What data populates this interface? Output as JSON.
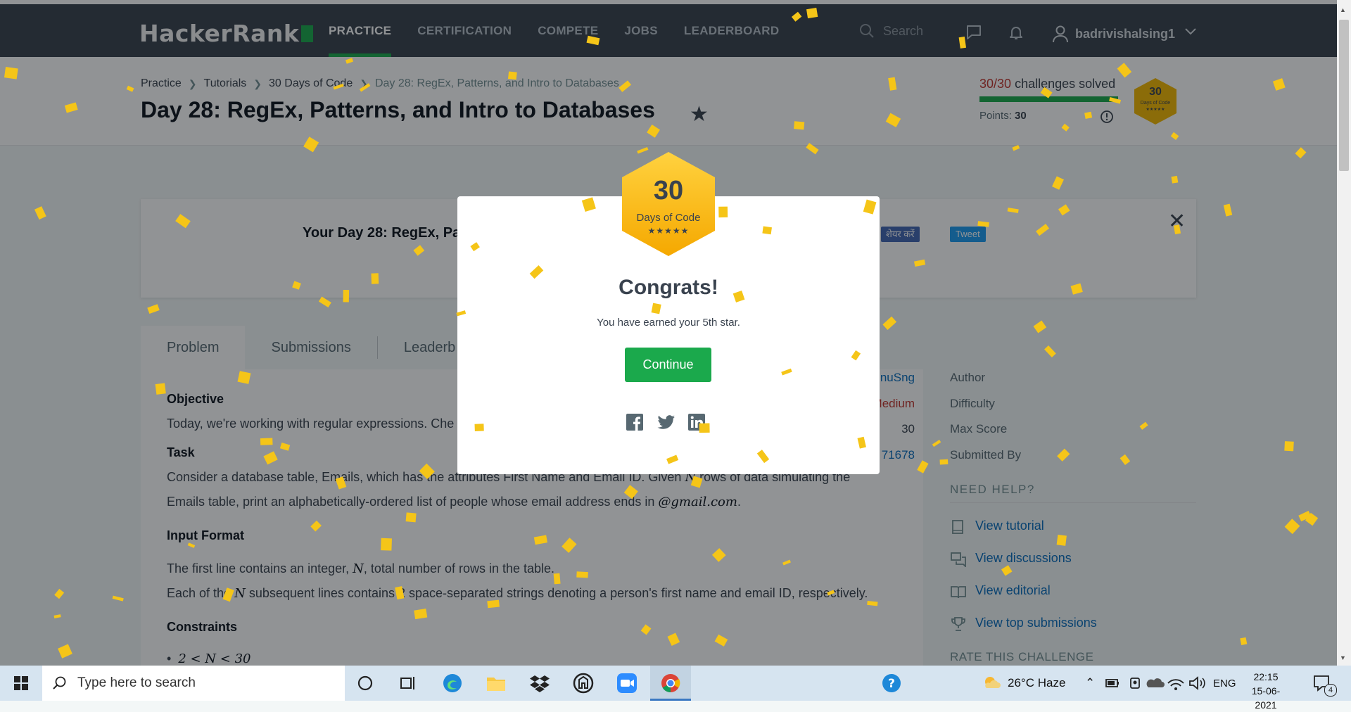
{
  "nav": {
    "logo": "HackerRank",
    "links": [
      "PRACTICE",
      "CERTIFICATION",
      "COMPETE",
      "JOBS",
      "LEADERBOARD"
    ],
    "search_placeholder": "Search",
    "username": "badrivishalsing1",
    "icons": [
      "messages-icon",
      "notifications-icon",
      "user-icon",
      "chevron-down-icon"
    ]
  },
  "breadcrumbs": [
    "Practice",
    "Tutorials",
    "30 Days of Code",
    "Day 28: RegEx, Patterns, and Intro to Databases"
  ],
  "title": "Day 28: RegEx, Patterns, and Intro to Databases",
  "progress": {
    "solved_num": "30/30",
    "solved_text": "challenges solved",
    "points_label": "Points:",
    "points_value": "30",
    "fraction": 1.0,
    "badge_num": "30",
    "badge_text": "Days of Code",
    "badge_stars": "★★★★★"
  },
  "banner": {
    "text": "Your Day 28: RegEx, Pa",
    "share_fb": "शेयर करें",
    "share_tw": "Tweet"
  },
  "tabs": [
    "Problem",
    "Submissions",
    "Leaderb"
  ],
  "problem": {
    "objective_heading": "Objective",
    "objective_text": "Today, we're working with regular expressions. Che",
    "task_heading": "Task",
    "task_line1_a": "Consider a database table, Emails, which has the attributes First Name and Email ID. Given ",
    "task_line1_math": "N",
    "task_line1_b": " rows of data simulating the",
    "task_line2_a": "Emails table, print an alphabetically-ordered list of people whose email address ends in ",
    "task_line2_math": "@gmail.com",
    "task_line2_b": ".",
    "input_heading": "Input Format",
    "input_line1_a": "The first line contains an integer, ",
    "input_line1_math": "N",
    "input_line1_b": ", total number of rows in the table.",
    "input_line2_a": "Each of the ",
    "input_line2_math": "N",
    "input_line2_b": " subsequent lines contains 2 space-separated strings denoting a person's first name and email ID, respectively.",
    "constraints_heading": "Constraints",
    "constraint_1": "2 < N < 30"
  },
  "sidebar": {
    "author_label": "Author",
    "author_value": "AvmnuSng",
    "difficulty_label": "Difficulty",
    "difficulty_value": "Medium",
    "max_score_label": "Max Score",
    "max_score_value": "30",
    "submitted_label": "Submitted By",
    "submitted_value": "71678",
    "need_help": "NEED HELP?",
    "help_links": [
      "View tutorial",
      "View discussions",
      "View editorial",
      "View top submissions"
    ],
    "rate": "RATE THIS CHALLENGE"
  },
  "modal": {
    "badge_num": "30",
    "badge_text": "Days of Code",
    "badge_stars": "★★★★★",
    "heading": "Congrats!",
    "message": "You have earned your 5th star.",
    "button": "Continue",
    "social": [
      "facebook-icon",
      "twitter-icon",
      "linkedin-icon"
    ]
  },
  "taskbar": {
    "search_placeholder": "Type here to search",
    "weather": "26°C  Haze",
    "lang": "ENG",
    "time": "22:15",
    "date": "15-06-2021",
    "notifications": "4"
  },
  "colors": {
    "nav_bg": "#39424e",
    "accent_green": "#1ba94c",
    "badge_gold": "#f5b800",
    "link_blue": "#0a6ebd",
    "medium_red": "#c2362f",
    "confetti": "#f5c518"
  }
}
